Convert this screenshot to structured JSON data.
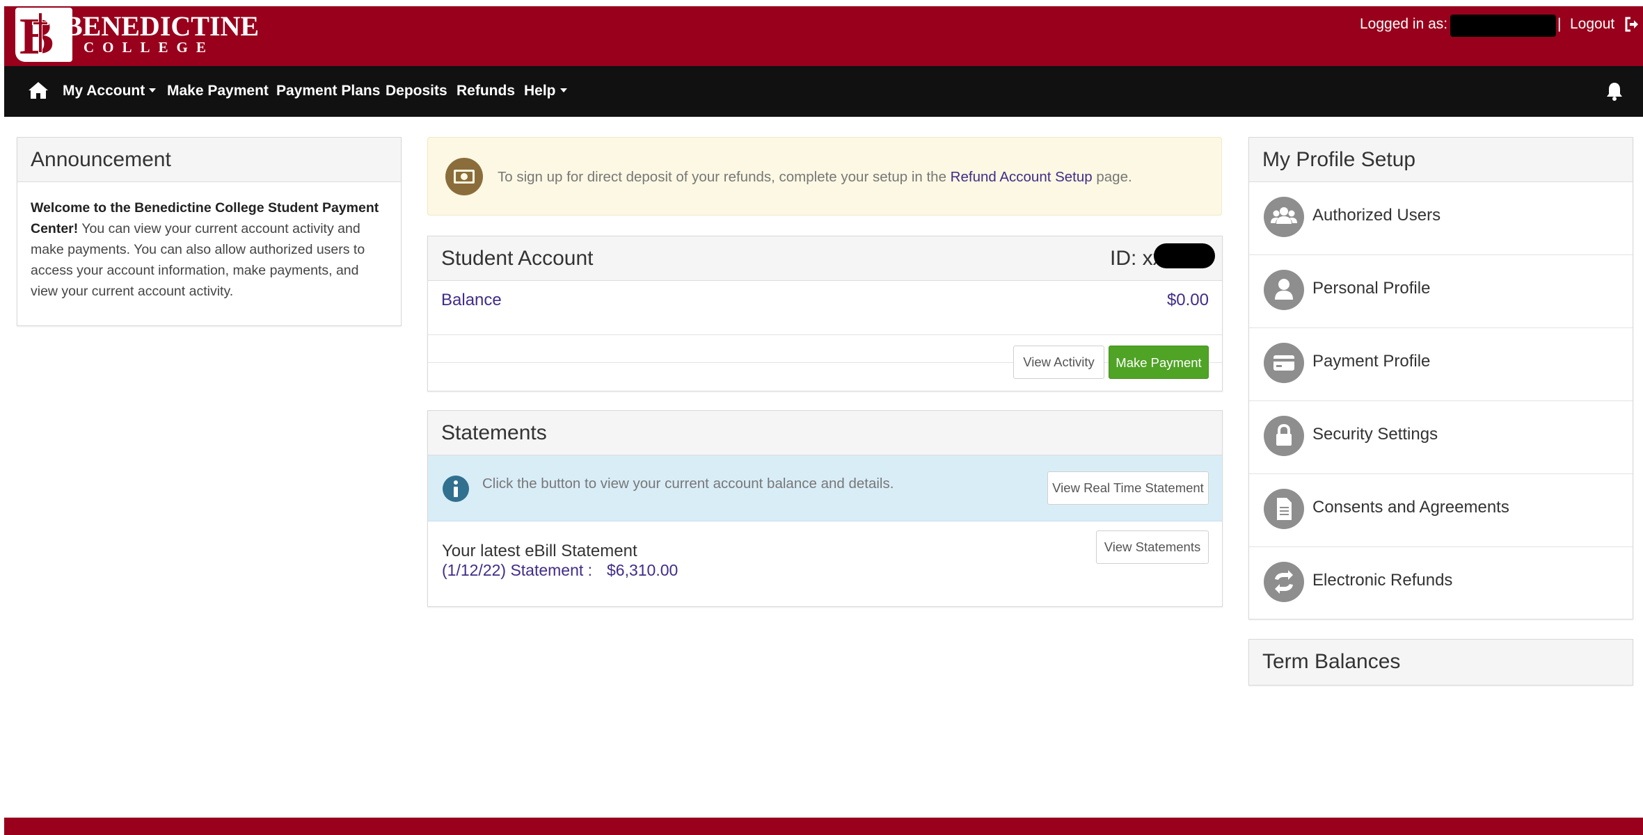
{
  "header": {
    "brand_name": "BENEDICTINE",
    "brand_sub": "COLLEGE",
    "logged_in_label": "Logged in as:",
    "separator": "|",
    "logout_label": "Logout",
    "colors": {
      "header_bg": "#98001c",
      "nav_bg": "#111111",
      "link": "#412c88",
      "success": "#4fa325"
    }
  },
  "nav": {
    "home_icon": "home-icon",
    "items": [
      {
        "label": "My Account",
        "dropdown": true
      },
      {
        "label": "Make Payment",
        "dropdown": false
      },
      {
        "label": "Payment Plans",
        "dropdown": false
      },
      {
        "label": "Deposits",
        "dropdown": false
      },
      {
        "label": "Refunds",
        "dropdown": false
      },
      {
        "label": "Help",
        "dropdown": true
      }
    ],
    "bell_icon": "bell-icon"
  },
  "announcement": {
    "title": "Announcement",
    "bold_intro": "Welcome to the Benedictine College Student Payment Center!",
    "body": " You can view your current account activity and make payments. You can also allow authorized users to access your account information, make payments, and view your current account activity."
  },
  "refund_notice": {
    "icon": "money-icon",
    "text_before": "To sign up for direct deposit of your refunds, complete your setup in the ",
    "link_text": "Refund Account Setup",
    "text_after": " page."
  },
  "student_account": {
    "title": "Student Account",
    "id_label": "ID: xxx",
    "balance_label": "Balance",
    "balance_value": "$0.00",
    "view_activity_label": "View Activity",
    "make_payment_label": "Make Payment"
  },
  "statements": {
    "title": "Statements",
    "info_icon": "info-icon",
    "info_text": "Click the button to view your current account balance and details.",
    "real_time_button": "View Real Time Statement",
    "latest_label": "Your latest eBill Statement",
    "latest_link": "(1/12/22) Statement :",
    "latest_amount": "$6,310.00",
    "view_statements_button": "View Statements"
  },
  "profile_setup": {
    "title": "My Profile Setup",
    "items": [
      {
        "label": "Authorized Users",
        "icon": "users-icon"
      },
      {
        "label": "Personal Profile",
        "icon": "person-icon"
      },
      {
        "label": "Payment Profile",
        "icon": "credit-card-icon"
      },
      {
        "label": "Security Settings",
        "icon": "lock-icon"
      },
      {
        "label": "Consents and Agreements",
        "icon": "document-icon"
      },
      {
        "label": "Electronic Refunds",
        "icon": "refresh-icon"
      }
    ]
  },
  "term_balances": {
    "title": "Term Balances"
  }
}
